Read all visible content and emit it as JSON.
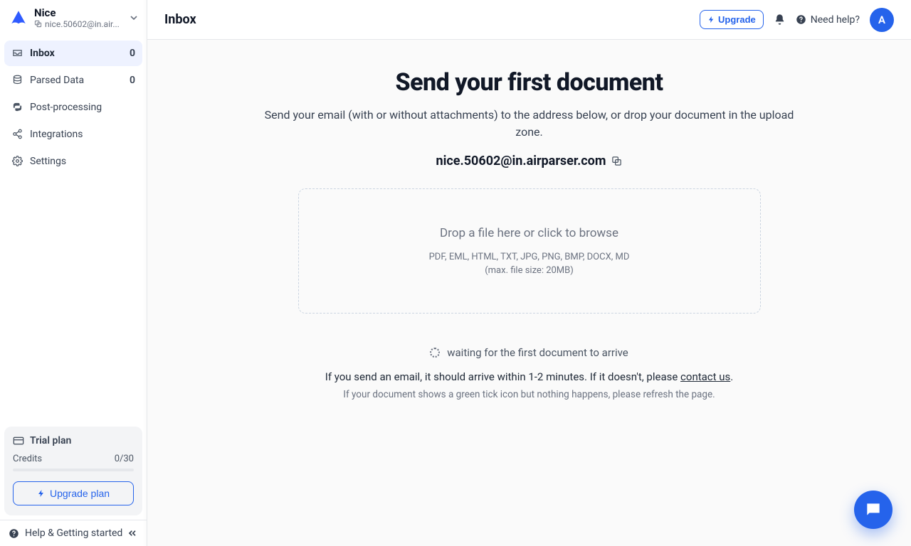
{
  "workspace": {
    "name": "Nice",
    "email_truncated": "nice.50602@in.air..."
  },
  "sidebar": {
    "items": [
      {
        "label": "Inbox",
        "count": "0"
      },
      {
        "label": "Parsed Data",
        "count": "0"
      },
      {
        "label": "Post-processing"
      },
      {
        "label": "Integrations"
      },
      {
        "label": "Settings"
      }
    ],
    "plan": {
      "title": "Trial plan",
      "credits_label": "Credits",
      "credits_value": "0/30",
      "upgrade": "Upgrade plan"
    },
    "footer": {
      "label": "Help & Getting started"
    }
  },
  "topbar": {
    "title": "Inbox",
    "upgrade": "Upgrade",
    "need_help": "Need help?",
    "avatar_initial": "A"
  },
  "main": {
    "heading": "Send your first document",
    "sub": "Send your email (with or without attachments) to the address below, or drop your document in the upload zone.",
    "email": "nice.50602@in.airparser.com",
    "dropzone": {
      "title": "Drop a file here or click to browse",
      "formats": "PDF, EML, HTML, TXT, JPG, PNG, BMP, DOCX, MD",
      "max": "(max. file size: 20MB)"
    },
    "waiting": "waiting for the first document to arrive",
    "hint1_a": "If you send an email, it should arrive within 1-2 minutes. If it doesn't, please ",
    "hint1_link": "contact us",
    "hint1_b": ".",
    "hint2": "If your document shows a green tick icon but nothing happens, please refresh the page."
  }
}
